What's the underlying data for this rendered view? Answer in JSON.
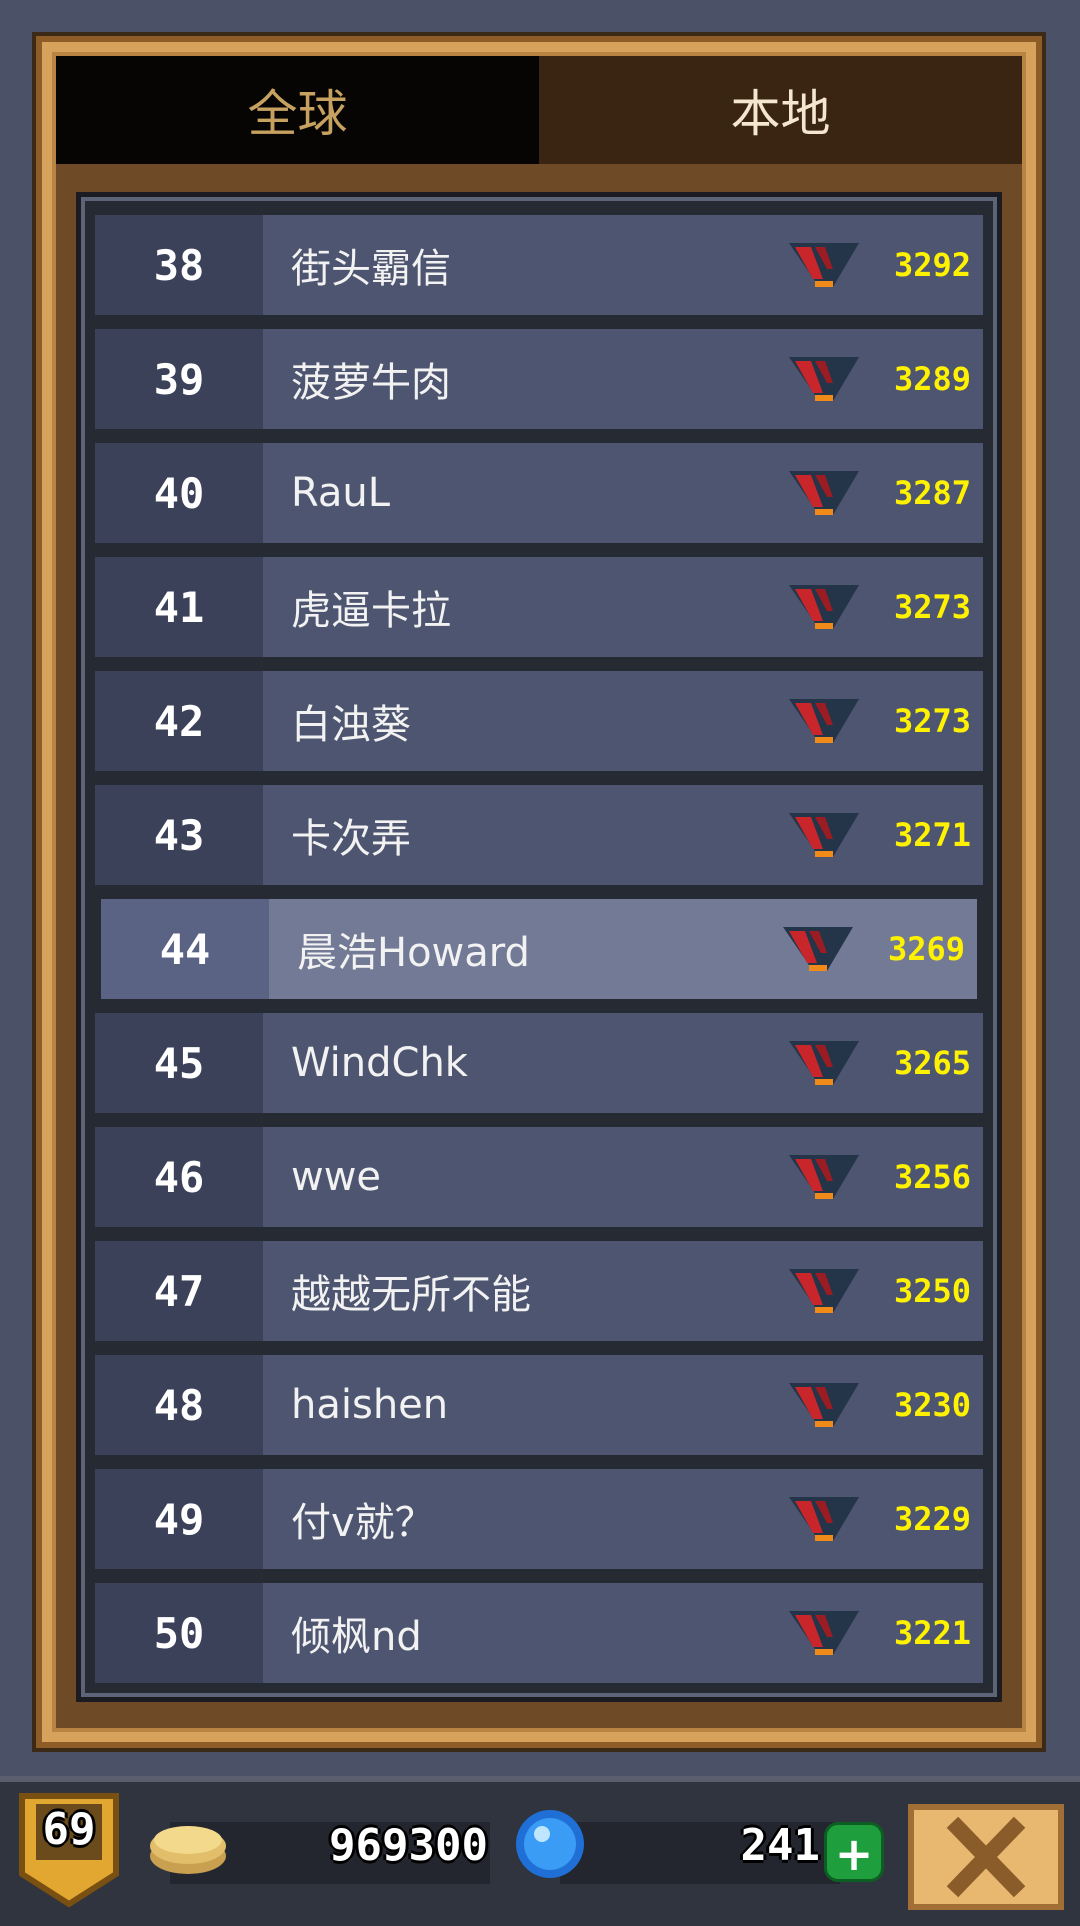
{
  "tabs": {
    "global": "全球",
    "local": "本地"
  },
  "leaderboard": [
    {
      "rank": "38",
      "name": "街头霸信",
      "score": "3292"
    },
    {
      "rank": "39",
      "name": "菠萝牛肉",
      "score": "3289"
    },
    {
      "rank": "40",
      "name": "RauL",
      "score": "3287"
    },
    {
      "rank": "41",
      "name": "虎逼卡拉",
      "score": "3273"
    },
    {
      "rank": "42",
      "name": "白浊葵",
      "score": "3273"
    },
    {
      "rank": "43",
      "name": "卡次弄",
      "score": "3271"
    },
    {
      "rank": "44",
      "name": "晨浩Howard",
      "score": "3269",
      "highlight": true
    },
    {
      "rank": "45",
      "name": "WindChk",
      "score": "3265"
    },
    {
      "rank": "46",
      "name": "wwe",
      "score": "3256"
    },
    {
      "rank": "47",
      "name": "越越无所不能",
      "score": "3250"
    },
    {
      "rank": "48",
      "name": "haishen",
      "score": "3230"
    },
    {
      "rank": "49",
      "name": "付v就？",
      "score": "3229"
    },
    {
      "rank": "50",
      "name": "倾枫nd",
      "score": "3221"
    }
  ],
  "player": {
    "level": "69",
    "coins": "969300",
    "gems": "241"
  },
  "icons": {
    "trophy": "trophy-icon",
    "coin": "coin-stack-icon",
    "gem": "blue-gem-icon",
    "plus": "plus-icon",
    "close": "close-icon",
    "level": "level-badge-icon"
  },
  "colors": {
    "score": "#fff200",
    "row": "#4e5570",
    "highlight_row": "#737a96",
    "frame": "#d7a35c"
  }
}
